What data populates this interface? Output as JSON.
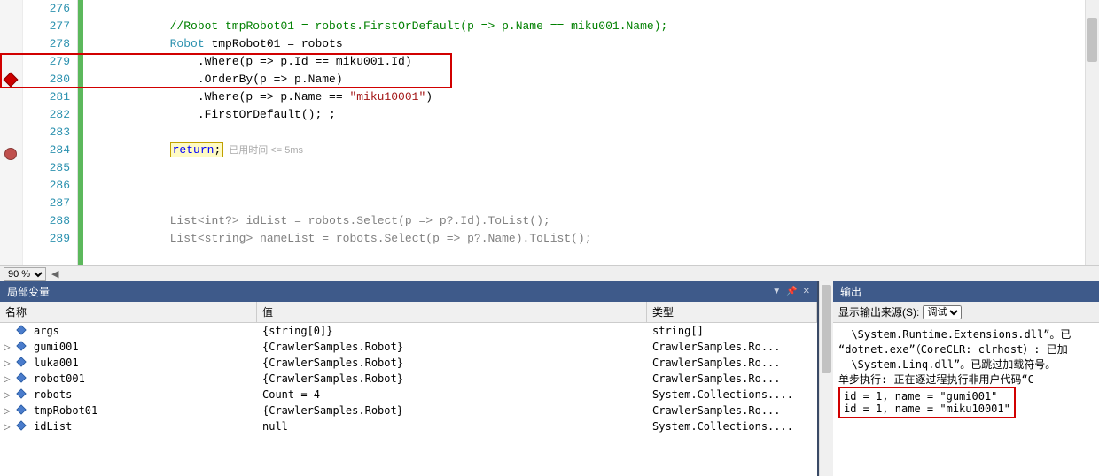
{
  "editor": {
    "lines": [
      {
        "num": 276,
        "html": ""
      },
      {
        "num": 277,
        "html": "            <span class='c-comment'>//Robot tmpRobot01 = robots.FirstOrDefault(p => p.Name == miku001.Name);</span>"
      },
      {
        "num": 278,
        "html": "            <span class='c-type'>Robot</span> tmpRobot01 = robots"
      },
      {
        "num": 279,
        "html": "                .Where(p => p.Id == miku001.Id)"
      },
      {
        "num": 280,
        "html": "                .OrderBy(p => p.Name)"
      },
      {
        "num": 281,
        "html": "                .Where(p => p.Name == <span class='c-string'>\"miku10001\"</span>)"
      },
      {
        "num": 282,
        "html": "                .FirstOrDefault(); ;"
      },
      {
        "num": 283,
        "html": ""
      },
      {
        "num": 284,
        "html": "            <span class='return-highlight'><span class='c-keyword'>return</span>;</span><span class='hint'>已用时间 <= 5ms</span>"
      },
      {
        "num": 285,
        "html": ""
      },
      {
        "num": 286,
        "html": ""
      },
      {
        "num": 287,
        "html": ""
      },
      {
        "num": 288,
        "html": "            <span class='c-type c-gray'>List</span><span class='c-gray'>&lt;</span><span class='c-keyword c-gray'>int</span><span class='c-gray'>?&gt; idList = robots.Select(p =&gt; p?.Id).ToList();</span>"
      },
      {
        "num": 289,
        "html": "            <span class='c-type c-gray'>List</span><span class='c-gray'>&lt;</span><span class='c-keyword c-gray'>string</span><span class='c-gray'>&gt; nameList = robots.Select(p =&gt; p?.Name).ToList();</span>"
      }
    ],
    "breakpoint_line": 280,
    "current_line": 284,
    "redbox_start": 279,
    "redbox_end": 280
  },
  "zoom": {
    "value": "90 %"
  },
  "locals": {
    "title": "局部变量",
    "headers": {
      "name": "名称",
      "value": "值",
      "type": "类型"
    },
    "rows": [
      {
        "exp": false,
        "name": "args",
        "value": "{string[0]}",
        "type": "string[]"
      },
      {
        "exp": true,
        "name": "gumi001",
        "value": "{CrawlerSamples.Robot}",
        "type": "CrawlerSamples.Ro..."
      },
      {
        "exp": true,
        "name": "luka001",
        "value": "{CrawlerSamples.Robot}",
        "type": "CrawlerSamples.Ro..."
      },
      {
        "exp": true,
        "name": "robot001",
        "value": "{CrawlerSamples.Robot}",
        "type": "CrawlerSamples.Ro..."
      },
      {
        "exp": true,
        "name": "robots",
        "value": "Count = 4",
        "type": "System.Collections...."
      },
      {
        "exp": true,
        "name": "tmpRobot01",
        "value": "{CrawlerSamples.Robot}",
        "type": "CrawlerSamples.Ro..."
      },
      {
        "exp": true,
        "name": "idList",
        "value": "null",
        "type": "System.Collections...."
      }
    ]
  },
  "output": {
    "title": "输出",
    "source_label": "显示输出来源(S):",
    "source_value": "调试",
    "lines_pre": [
      "  \\System.Runtime.Extensions.dll”。已",
      "“dotnet.exe”（CoreCLR: clrhost）: 已加",
      "  \\System.Linq.dll”。已跳过加载符号。",
      "单步执行: 正在逐过程执行非用户代码“C"
    ],
    "lines_boxed": [
      "id = 1, name = \"gumi001\"",
      "id = 1, name = \"miku10001\""
    ]
  }
}
